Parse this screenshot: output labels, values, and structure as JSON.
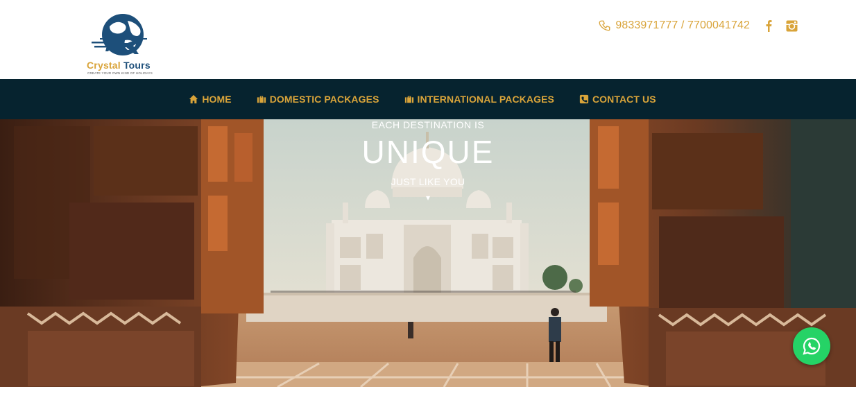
{
  "brand": {
    "name_part1": "Crystal",
    "name_part2": "Tours",
    "tagline": "CREATE YOUR OWN KIND OF HOLIDAYS",
    "icon": "globe-airplane-logo"
  },
  "header": {
    "phones": "9833971777 / 7700041742",
    "phone_icon": "phone-icon",
    "social": [
      {
        "name": "facebook",
        "icon": "facebook-icon"
      },
      {
        "name": "instagram",
        "icon": "instagram-icon"
      }
    ]
  },
  "nav": {
    "items": [
      {
        "label": "HOME",
        "icon": "home-icon"
      },
      {
        "label": "DOMESTIC PACKAGES",
        "icon": "briefcase-icon"
      },
      {
        "label": "INTERNATIONAL PACKAGES",
        "icon": "briefcase-icon"
      },
      {
        "label": "CONTACT US",
        "icon": "phone-square-icon"
      }
    ]
  },
  "hero": {
    "line1": "EACH DESTINATION IS",
    "line2": "UNIQUE",
    "line3": "JUST LIKE YOU",
    "line4": "▾"
  },
  "floating": {
    "whatsapp_icon": "whatsapp-icon"
  },
  "colors": {
    "accent": "#d9a43a",
    "nav_bg": "#06232f",
    "logo_blue": "#1d4f7a",
    "whatsapp": "#25d366"
  }
}
